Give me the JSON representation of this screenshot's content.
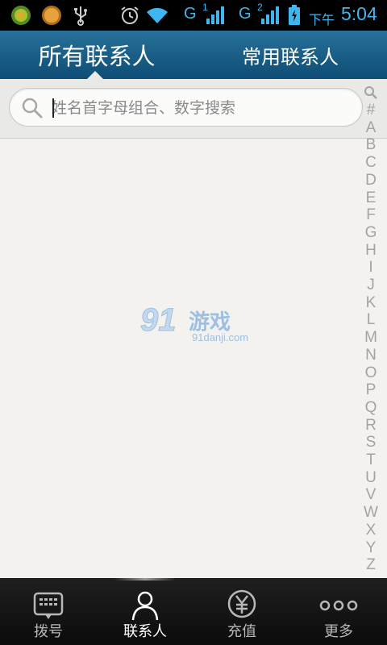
{
  "status_bar": {
    "network_label_1": "G",
    "sim_1": "1",
    "network_label_2": "G",
    "sim_2": "2",
    "period": "下午",
    "time": "5:04",
    "icons": [
      "app-green-icon",
      "app-orange-icon",
      "usb-icon",
      "alarm-icon",
      "wifi-icon",
      "signal-icon",
      "signal-icon",
      "battery-charging-icon"
    ]
  },
  "tabs": {
    "all_contacts": "所有联系人",
    "frequent_contacts": "常用联系人",
    "active": "all_contacts"
  },
  "search": {
    "placeholder": "姓名首字母组合、数字搜索",
    "value": ""
  },
  "index_bar": [
    "#",
    "A",
    "B",
    "C",
    "D",
    "E",
    "F",
    "G",
    "H",
    "I",
    "J",
    "K",
    "L",
    "M",
    "N",
    "O",
    "P",
    "Q",
    "R",
    "S",
    "T",
    "U",
    "V",
    "W",
    "X",
    "Y",
    "Z"
  ],
  "watermark": {
    "brand": "91游戏",
    "domain": "91danji.com"
  },
  "bottom_nav": [
    {
      "label": "拨号",
      "icon": "dialpad-icon"
    },
    {
      "label": "联系人",
      "icon": "person-icon"
    },
    {
      "label": "充值",
      "icon": "yuan-icon"
    },
    {
      "label": "更多",
      "icon": "more-icon"
    }
  ],
  "colors": {
    "header": "#1a5f87",
    "status_accent": "#3fb6f0",
    "background": "#f3f2ef"
  }
}
